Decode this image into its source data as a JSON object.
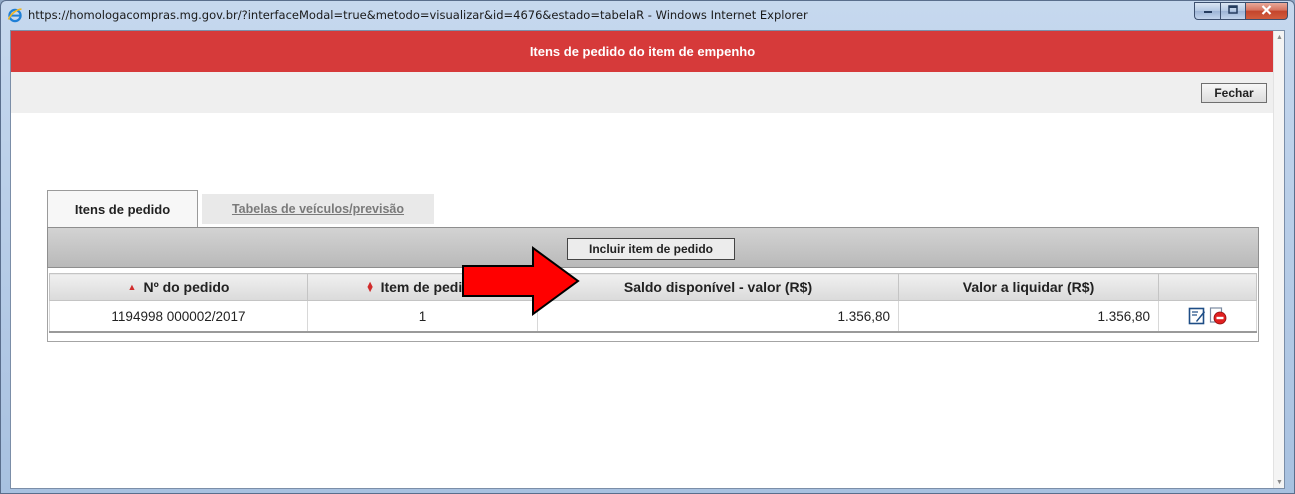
{
  "window": {
    "title": "https://homologacompras.mg.gov.br/?interfaceModal=true&metodo=visualizar&id=4676&estado=tabelaR - Windows Internet Explorer",
    "icon": "ie-icon",
    "controls": {
      "minimize": "minimize-icon",
      "maximize": "maximize-icon",
      "close": "close-icon"
    }
  },
  "header": {
    "title": "Itens de pedido do item de empenho"
  },
  "toolbar": {
    "close_label": "Fechar"
  },
  "tabs": [
    {
      "label": "Itens de pedido",
      "active": true
    },
    {
      "label": "Tabelas de veículos/previsão",
      "active": false
    }
  ],
  "actions": {
    "add_label": "Incluir item de pedido"
  },
  "grid": {
    "columns": [
      {
        "label": "Nº do pedido",
        "sort": "ascending"
      },
      {
        "label": "Item de pedido",
        "sort": "sortable"
      },
      {
        "label": "Saldo disponível - valor (R$)",
        "sort": "none"
      },
      {
        "label": "Valor a liquidar (R$)",
        "sort": "none"
      },
      {
        "label": "",
        "sort": "none"
      }
    ],
    "rows": [
      {
        "numero_pedido": "1194998 000002/2017",
        "item_pedido": "1",
        "saldo_disponivel": "1.356,80",
        "valor_liquidar": "1.356,80",
        "actions": [
          "edit-icon",
          "delete-icon"
        ]
      }
    ]
  },
  "colors": {
    "header_bg": "#d63a3a",
    "arrow": "#ff0000",
    "sort_indicator": "#d12c2c"
  }
}
